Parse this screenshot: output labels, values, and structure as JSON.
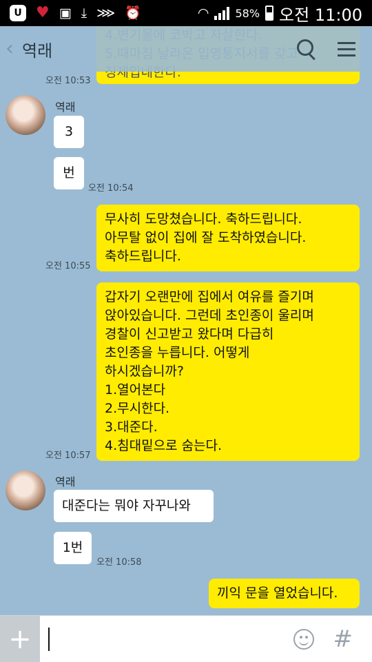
{
  "status_bar": {
    "badge": "U",
    "battery_text": "58%",
    "battery_level": 0.58,
    "time": "오전 11:00",
    "icons": [
      "app-badge",
      "heart-icon",
      "image-icon",
      "download-icon",
      "vibrate-icon",
      "alarm-icon",
      "wifi-icon",
      "signal-icon",
      "battery-icon"
    ]
  },
  "header": {
    "title": "역래",
    "icons": [
      "back-icon",
      "search-icon",
      "menu-icon"
    ]
  },
  "messages": [
    {
      "from": "me",
      "text": "4.변기물에 코박고 자살한다.\n5.때마침 날라온 입영통지서를 갖고\n징제입네한다.",
      "time": "오전 10:53"
    },
    {
      "from": "them",
      "sender": "역래",
      "text": "3"
    },
    {
      "from": "them",
      "text": "번",
      "time": "오전 10:54"
    },
    {
      "from": "me",
      "text": "무사히 도망쳤습니다. 축하드립니다.\n아무탈 없이 집에 잘 도착하였습니다.\n축하드립니다.",
      "time": "오전 10:55"
    },
    {
      "from": "me",
      "text": "갑자기 오랜만에 집에서 여유를 즐기며\n앉아있습니다. 그런데 초인종이 울리며\n경찰이 신고받고 왔다며 다급히\n초인종을 누릅니다. 어떻게\n하시겠습니까?\n1.열어본다\n2.무시한다.\n3.대준다.\n4.침대밑으로 숨는다.",
      "time": "오전 10:57"
    },
    {
      "from": "them",
      "sender": "역래",
      "text": "대준다는 뭐야 자꾸나와"
    },
    {
      "from": "them",
      "text": "1번",
      "time": "오전 10:58"
    },
    {
      "from": "me",
      "text": "끼익 문을 열었습니다."
    }
  ],
  "input": {
    "plus_label": "+",
    "placeholder": "",
    "hash_label": "#"
  }
}
